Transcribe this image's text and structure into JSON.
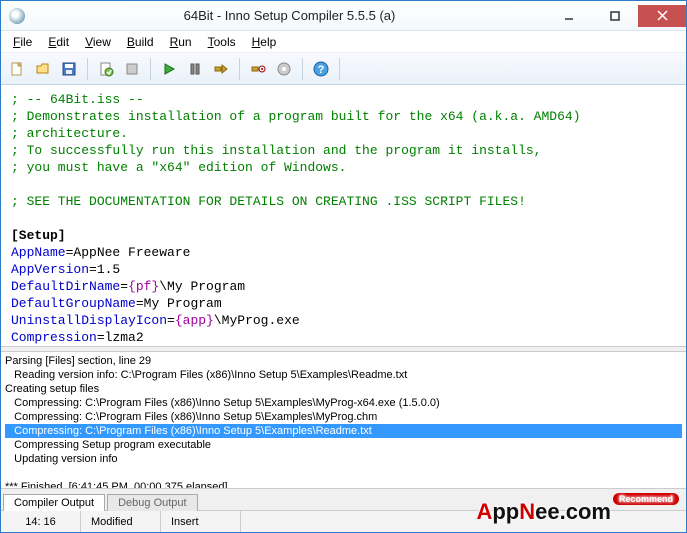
{
  "title": "64Bit - Inno Setup Compiler 5.5.5 (a)",
  "menu": [
    "File",
    "Edit",
    "View",
    "Build",
    "Run",
    "Tools",
    "Help"
  ],
  "toolbar_icons": [
    "new",
    "open",
    "save",
    "compile",
    "stop",
    "run",
    "pause",
    "step",
    "target",
    "options",
    "help"
  ],
  "editor_lines": [
    {
      "t": "comment",
      "s": "; -- 64Bit.iss --"
    },
    {
      "t": "comment",
      "s": "; Demonstrates installation of a program built for the x64 (a.k.a. AMD64)"
    },
    {
      "t": "comment",
      "s": "; architecture."
    },
    {
      "t": "comment",
      "s": "; To successfully run this installation and the program it installs,"
    },
    {
      "t": "comment",
      "s": "; you must have a \"x64\" edition of Windows."
    },
    {
      "t": "blank",
      "s": ""
    },
    {
      "t": "comment",
      "s": "; SEE THE DOCUMENTATION FOR DETAILS ON CREATING .ISS SCRIPT FILES!"
    },
    {
      "t": "blank",
      "s": ""
    },
    {
      "t": "section",
      "s": "[Setup]"
    },
    {
      "t": "kv",
      "k": "AppName",
      "v": "AppNee Freeware"
    },
    {
      "t": "kv",
      "k": "AppVersion",
      "v": "1.5"
    },
    {
      "t": "kvconst",
      "k": "DefaultDirName",
      "c": "{pf}",
      "v": "\\My Program"
    },
    {
      "t": "kv",
      "k": "DefaultGroupName",
      "v": "My Program"
    },
    {
      "t": "kvconst",
      "k": "UninstallDisplayIcon",
      "c": "{app}",
      "v": "\\MyProg.exe"
    },
    {
      "t": "kv",
      "k": "Compression",
      "v": "lzma2"
    }
  ],
  "output": {
    "lines": [
      {
        "indent": 0,
        "s": "Parsing [Files] section, line 29"
      },
      {
        "indent": 1,
        "s": "Reading version info: C:\\Program Files (x86)\\Inno Setup 5\\Examples\\Readme.txt"
      },
      {
        "indent": 0,
        "s": "Creating setup files"
      },
      {
        "indent": 1,
        "s": "Compressing: C:\\Program Files (x86)\\Inno Setup 5\\Examples\\MyProg-x64.exe   (1.5.0.0)"
      },
      {
        "indent": 1,
        "s": "Compressing: C:\\Program Files (x86)\\Inno Setup 5\\Examples\\MyProg.chm"
      },
      {
        "indent": 1,
        "sel": true,
        "s": "Compressing: C:\\Program Files (x86)\\Inno Setup 5\\Examples\\Readme.txt"
      },
      {
        "indent": 1,
        "s": "Compressing Setup program executable"
      },
      {
        "indent": 1,
        "s": "Updating version info"
      },
      {
        "indent": 0,
        "blank": true,
        "s": ""
      },
      {
        "indent": 0,
        "s": "*** Finished.  [6:41:45 PM, 00:00.375 elapsed]"
      }
    ],
    "tabs": [
      "Compiler Output",
      "Debug Output"
    ],
    "active_tab": 0
  },
  "status": {
    "pos": "14:  16",
    "mod": "Modified",
    "ins": "Insert"
  },
  "watermark": {
    "a": "A",
    "pp": "pp",
    "n": "N",
    "ee": "ee",
    "dot": ".com",
    "rec": "Recommend"
  }
}
